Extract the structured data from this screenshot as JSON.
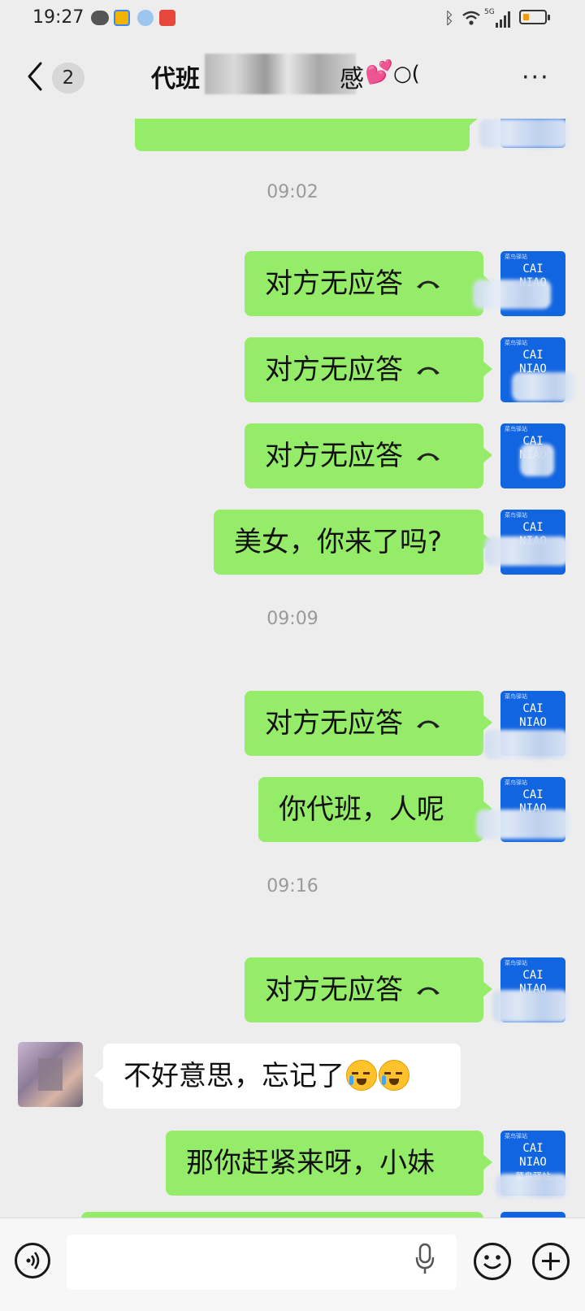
{
  "status_bar": {
    "time": "19:27",
    "network_label": "5G",
    "battery_percent": 30
  },
  "header": {
    "unread_count": "2",
    "title_visible": "代班",
    "title_tail": "感",
    "title_tail2": "○(",
    "more": "···"
  },
  "messages": [
    {
      "type": "time",
      "text": "09:02"
    },
    {
      "type": "sent",
      "text": "对方无应答",
      "icon": "call-hangup-icon"
    },
    {
      "type": "sent",
      "text": "对方无应答",
      "icon": "call-hangup-icon"
    },
    {
      "type": "sent",
      "text": "对方无应答",
      "icon": "call-hangup-icon"
    },
    {
      "type": "sent",
      "text": "美女，你来了吗?"
    },
    {
      "type": "time",
      "text": "09:09"
    },
    {
      "type": "sent",
      "text": "对方无应答",
      "icon": "call-hangup-icon"
    },
    {
      "type": "sent",
      "text": "你代班，人呢"
    },
    {
      "type": "time",
      "text": "09:16"
    },
    {
      "type": "sent",
      "text": "对方无应答",
      "icon": "call-hangup-icon"
    },
    {
      "type": "received",
      "text": "不好意思，忘记了",
      "emoji": [
        "crying-laughing-emoji",
        "crying-laughing-emoji"
      ]
    },
    {
      "type": "sent",
      "text": "那你赶紧来呀，小妹"
    }
  ],
  "avatar_me": {
    "brand_line1": "CAI",
    "brand_line2": "NIAO",
    "brand_line3": "菜鸟驿站"
  },
  "colors": {
    "sent_bubble": "#95ec69",
    "received_bubble": "#ffffff",
    "background": "#ededed",
    "avatar_blue": "#1265e0"
  }
}
